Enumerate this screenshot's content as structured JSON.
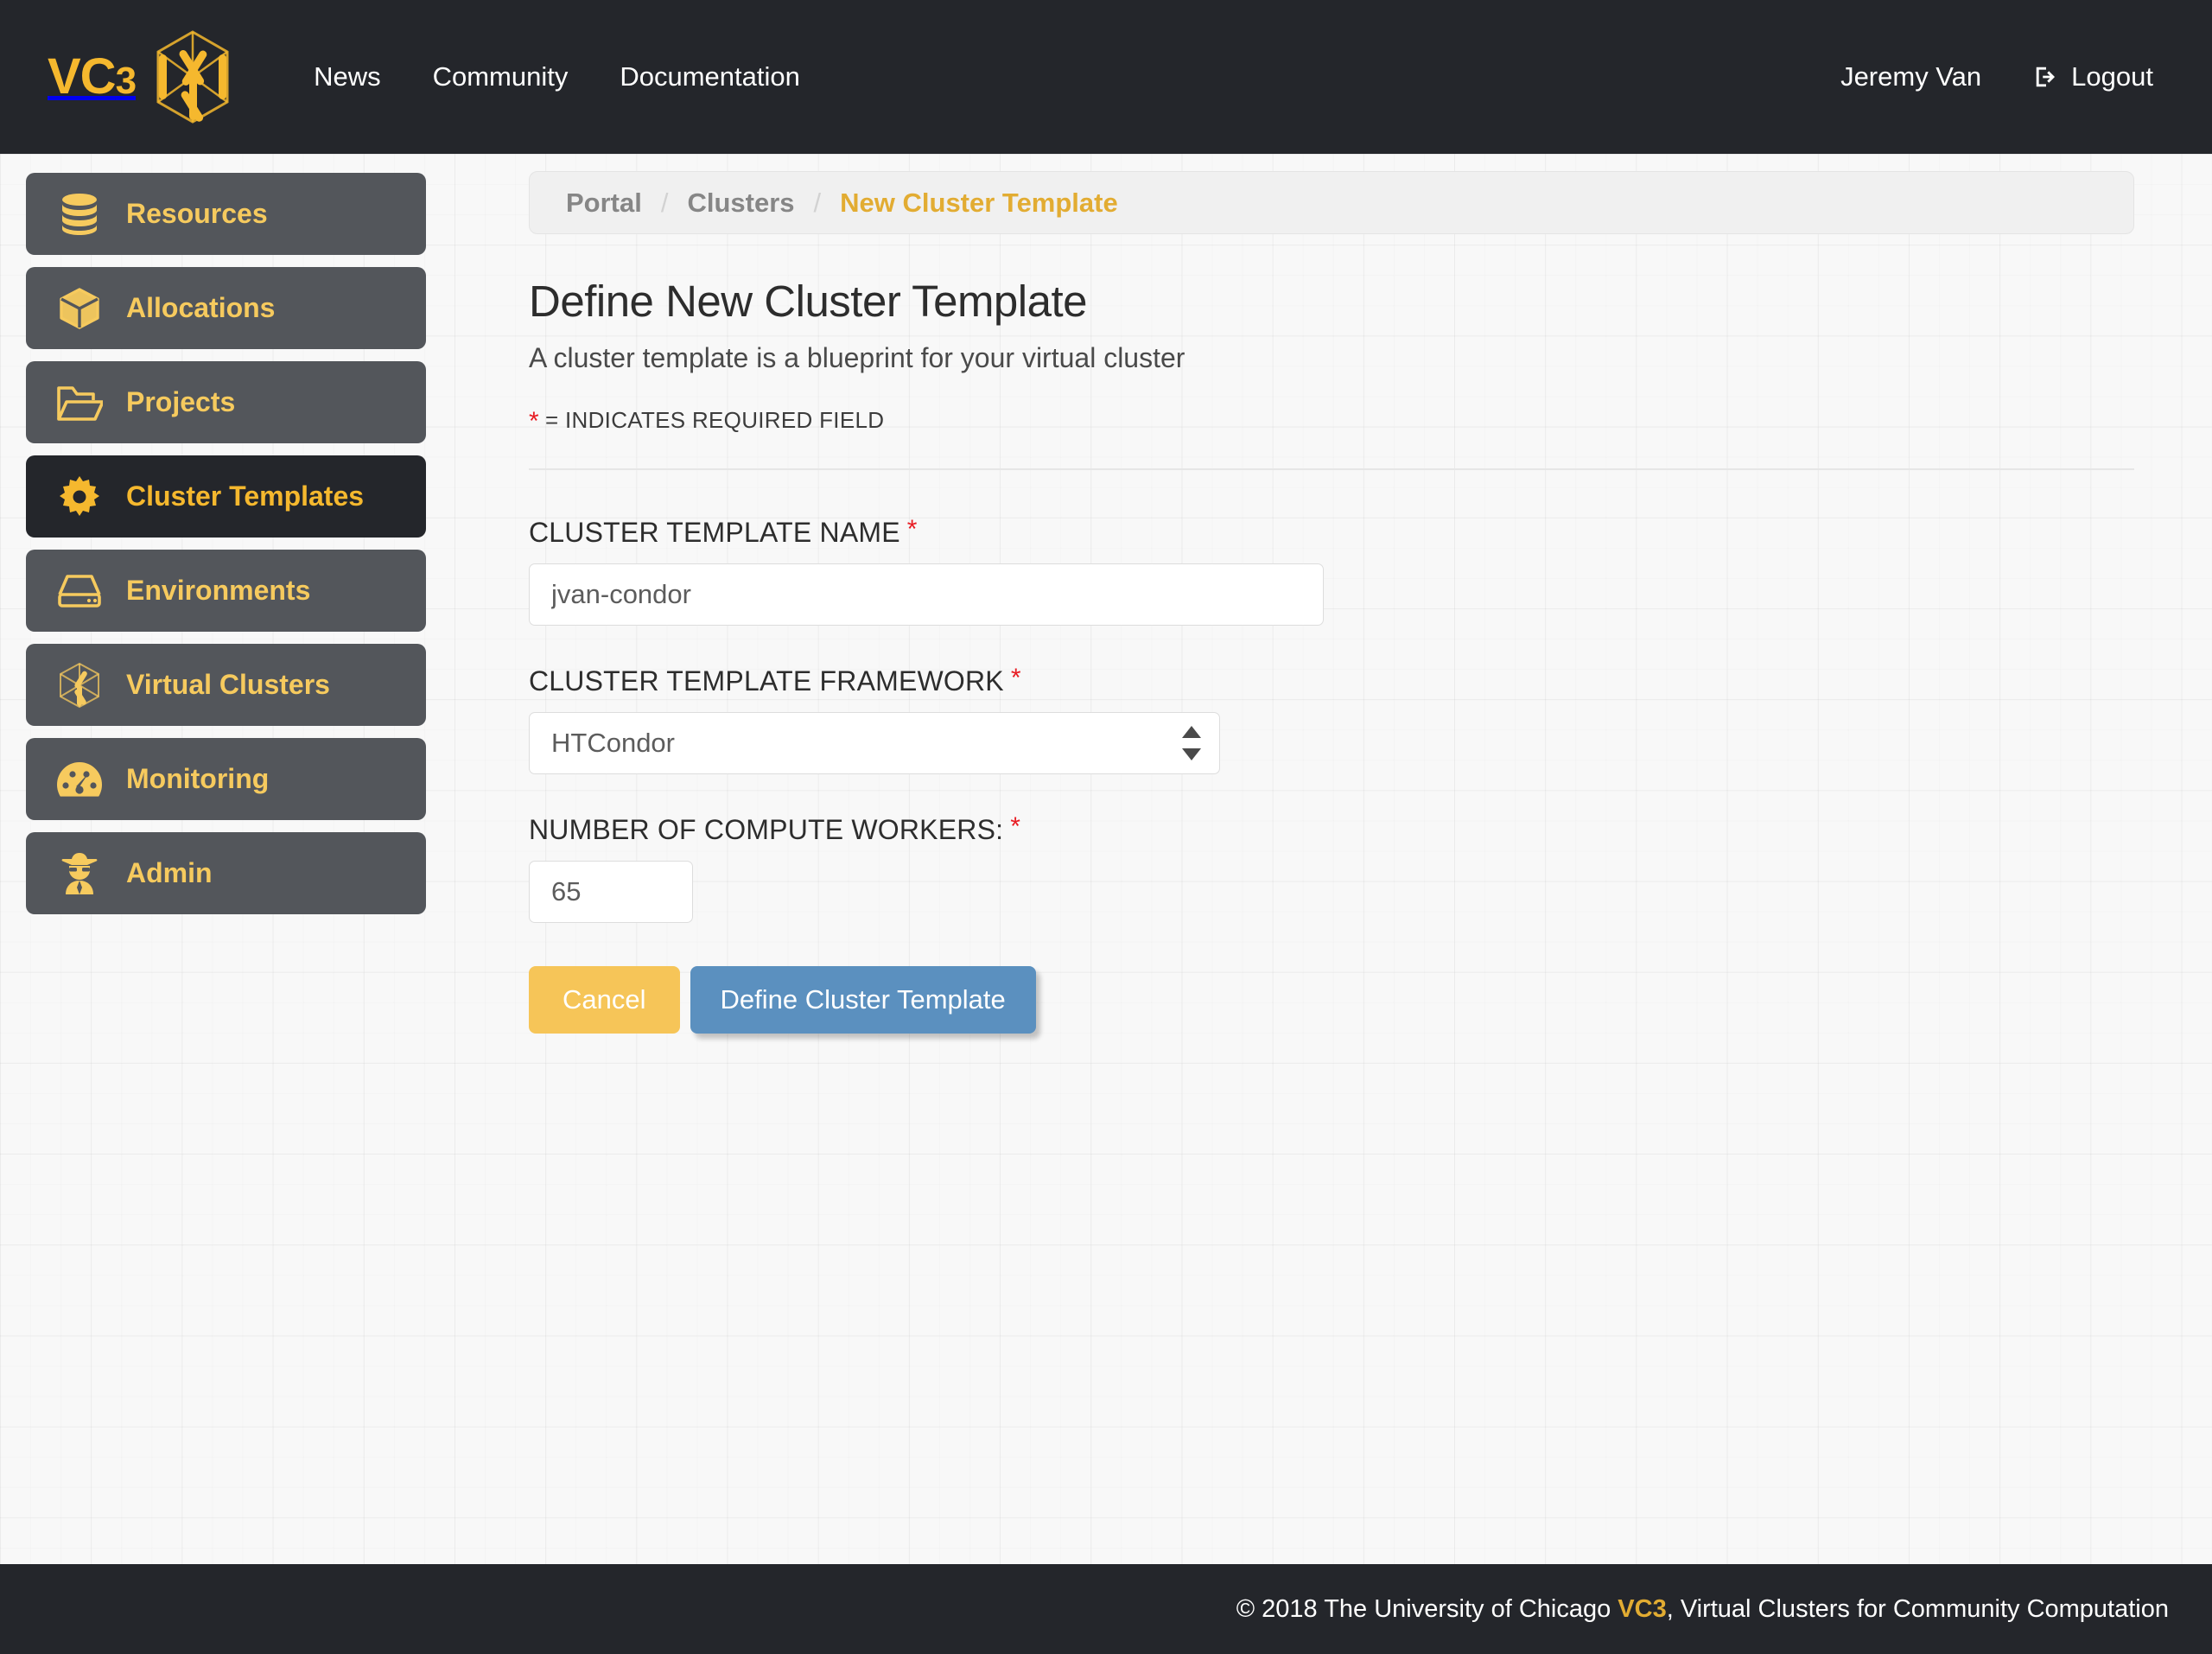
{
  "header": {
    "brand_main": "VC",
    "brand_sub": "3",
    "logo_icon": "vc3-hexagon-logo-icon",
    "nav_links": [
      {
        "label": "News",
        "name": "nav-link-news"
      },
      {
        "label": "Community",
        "name": "nav-link-community"
      },
      {
        "label": "Documentation",
        "name": "nav-link-documentation"
      }
    ],
    "user_name": "Jeremy Van",
    "logout_label": "Logout",
    "logout_icon": "sign-out-icon"
  },
  "sidebar": {
    "items": [
      {
        "label": "Resources",
        "icon": "database-icon",
        "active": false
      },
      {
        "label": "Allocations",
        "icon": "cube-icon",
        "active": false
      },
      {
        "label": "Projects",
        "icon": "folder-open-icon",
        "active": false
      },
      {
        "label": "Cluster Templates",
        "icon": "gear-icon",
        "active": true
      },
      {
        "label": "Environments",
        "icon": "hard-drive-icon",
        "active": false
      },
      {
        "label": "Virtual Clusters",
        "icon": "hexagon-cube-icon",
        "active": false
      },
      {
        "label": "Monitoring",
        "icon": "dashboard-gauge-icon",
        "active": false
      },
      {
        "label": "Admin",
        "icon": "user-secret-icon",
        "active": false
      }
    ]
  },
  "breadcrumb": {
    "items": [
      {
        "label": "Portal",
        "current": false
      },
      {
        "label": "Clusters",
        "current": false
      },
      {
        "label": "New Cluster Template",
        "current": true
      }
    ],
    "separator": "/"
  },
  "main": {
    "title": "Define New Cluster Template",
    "subtitle": "A cluster template is a blueprint for your virtual cluster",
    "required_star": "*",
    "required_note": "= INDICATES REQUIRED FIELD",
    "fields": {
      "name": {
        "label": "CLUSTER TEMPLATE NAME",
        "value": "jvan-condor",
        "placeholder": "",
        "required": "*"
      },
      "framework": {
        "label": "CLUSTER TEMPLATE FRAMEWORK",
        "value": "HTCondor",
        "required": "*",
        "options": [
          "HTCondor"
        ]
      },
      "workers": {
        "label": "NUMBER OF COMPUTE WORKERS:",
        "value": "65",
        "placeholder": "",
        "required": "*"
      }
    },
    "buttons": {
      "cancel": "Cancel",
      "submit": "Define Cluster Template"
    }
  },
  "footer": {
    "text_before": "© 2018 The University of Chicago ",
    "brand": "VC3",
    "text_after": ", Virtual Clusters for Community Computation"
  },
  "colors": {
    "brand_yellow": "#f5b82e",
    "sidebar_label": "#f6ca5e",
    "dark": "#24262b",
    "sidebar_item": "#53565b",
    "primary_blue": "#5b90bf",
    "cancel_yellow": "#f6c558",
    "required_red": "#e81c23",
    "crumb_current": "#e2ac32"
  }
}
